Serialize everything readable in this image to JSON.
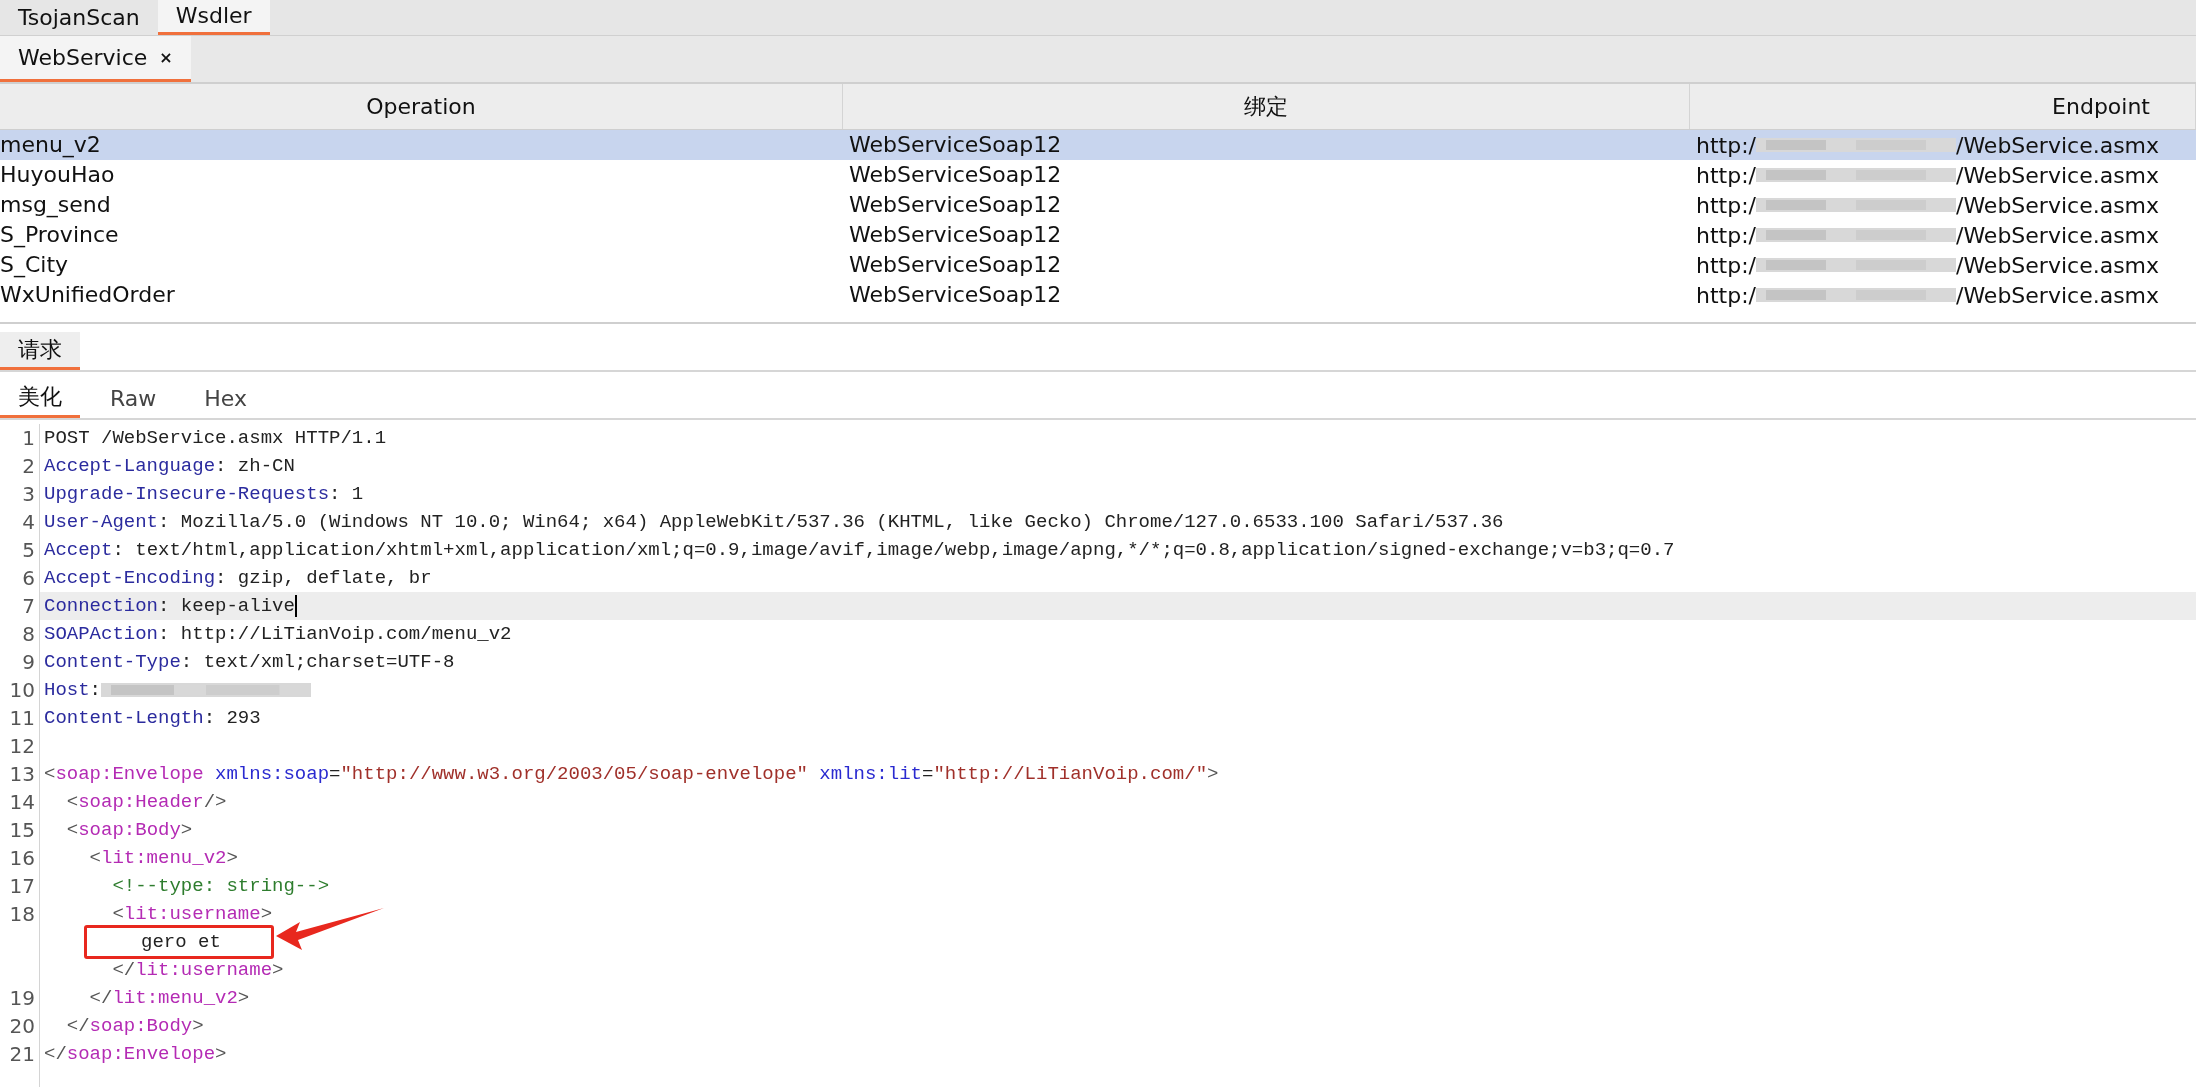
{
  "top_tabs": [
    {
      "label": "TsojanScan",
      "selected": false
    },
    {
      "label": "Wsdler",
      "selected": true
    }
  ],
  "doc_tabs": [
    {
      "label": "WebService",
      "close": "×",
      "selected": true
    }
  ],
  "table": {
    "columns": [
      "Operation",
      "绑定",
      "Endpoint"
    ],
    "rows": [
      {
        "operation": "menu_v2",
        "binding": "WebServiceSoap12",
        "endpoint_prefix": "http:/",
        "endpoint_suffix": "/WebService.asmx",
        "selected": true
      },
      {
        "operation": "HuyouHao",
        "binding": "WebServiceSoap12",
        "endpoint_prefix": "http:/",
        "endpoint_suffix": "/WebService.asmx",
        "selected": false
      },
      {
        "operation": "msg_send",
        "binding": "WebServiceSoap12",
        "endpoint_prefix": "http:/",
        "endpoint_suffix": "/WebService.asmx",
        "selected": false
      },
      {
        "operation": "S_Province",
        "binding": "WebServiceSoap12",
        "endpoint_prefix": "http:/",
        "endpoint_suffix": "/WebService.asmx",
        "selected": false
      },
      {
        "operation": "S_City",
        "binding": "WebServiceSoap12",
        "endpoint_prefix": "http:/",
        "endpoint_suffix": "/WebService.asmx",
        "selected": false
      },
      {
        "operation": "WxUnifiedOrder",
        "binding": "WebServiceSoap12",
        "endpoint_prefix": "http:/",
        "endpoint_suffix": "/WebService.asmx",
        "selected": false
      }
    ]
  },
  "panel_tabs": [
    {
      "label": "请求",
      "selected": true
    }
  ],
  "view_tabs": [
    {
      "label": "美化",
      "selected": true
    },
    {
      "label": "Raw",
      "selected": false
    },
    {
      "label": "Hex",
      "selected": false
    }
  ],
  "code": [
    {
      "number": "1",
      "current": false,
      "rows": [
        {
          "segments": [
            {
              "kind": "plain",
              "text": "POST /WebService.asmx HTTP/1.1"
            }
          ]
        }
      ]
    },
    {
      "number": "2",
      "current": false,
      "rows": [
        {
          "segments": [
            {
              "kind": "key",
              "text": "Accept-Language"
            },
            {
              "kind": "plain",
              "text": ": zh-CN"
            }
          ]
        }
      ]
    },
    {
      "number": "3",
      "current": false,
      "rows": [
        {
          "segments": [
            {
              "kind": "key",
              "text": "Upgrade-Insecure-Requests"
            },
            {
              "kind": "plain",
              "text": ": 1"
            }
          ]
        }
      ]
    },
    {
      "number": "4",
      "current": false,
      "rows": [
        {
          "segments": [
            {
              "kind": "key",
              "text": "User-Agent"
            },
            {
              "kind": "plain",
              "text": ": Mozilla/5.0 (Windows NT 10.0; Win64; x64) AppleWebKit/537.36 (KHTML, like Gecko) Chrome/127.0.6533.100 Safari/537.36"
            }
          ]
        }
      ]
    },
    {
      "number": "5",
      "current": false,
      "rows": [
        {
          "segments": [
            {
              "kind": "key",
              "text": "Accept"
            },
            {
              "kind": "plain",
              "text": ": text/html,application/xhtml+xml,application/xml;q=0.9,image/avif,image/webp,image/apng,*/*;q=0.8,application/signed-exchange;v=b3;q=0.7"
            }
          ]
        }
      ]
    },
    {
      "number": "6",
      "current": false,
      "rows": [
        {
          "segments": [
            {
              "kind": "key",
              "text": "Accept-Encoding"
            },
            {
              "kind": "plain",
              "text": ": gzip, deflate, br"
            }
          ]
        }
      ]
    },
    {
      "number": "7",
      "current": true,
      "rows": [
        {
          "segments": [
            {
              "kind": "key",
              "text": "Connection"
            },
            {
              "kind": "plain",
              "text": ": keep-alive"
            }
          ]
        }
      ]
    },
    {
      "number": "8",
      "current": false,
      "rows": [
        {
          "segments": [
            {
              "kind": "key",
              "text": "SOAPAction"
            },
            {
              "kind": "plain",
              "text": ": http://LiTianVoip.com/menu_v2"
            }
          ]
        }
      ]
    },
    {
      "number": "9",
      "current": false,
      "rows": [
        {
          "segments": [
            {
              "kind": "key",
              "text": "Content-Type"
            },
            {
              "kind": "plain",
              "text": ": text/xml;charset=UTF-8"
            }
          ]
        }
      ]
    },
    {
      "number": "10",
      "current": false,
      "rows": [
        {
          "segments": [
            {
              "kind": "key",
              "text": "Host"
            },
            {
              "kind": "plain",
              "text": ":"
            },
            {
              "kind": "redacted"
            }
          ]
        }
      ]
    },
    {
      "number": "11",
      "current": false,
      "rows": [
        {
          "segments": [
            {
              "kind": "key",
              "text": "Content-Length"
            },
            {
              "kind": "plain",
              "text": ": 293"
            }
          ]
        }
      ]
    },
    {
      "number": "12",
      "current": false,
      "rows": [
        {
          "segments": []
        }
      ]
    },
    {
      "number": "13",
      "current": false,
      "rows": [
        {
          "segments": [
            {
              "kind": "punct",
              "text": "<"
            },
            {
              "kind": "tag",
              "text": "soap:Envelope"
            },
            {
              "kind": "attr",
              "text": " xmlns:soap"
            },
            {
              "kind": "plain",
              "text": "="
            },
            {
              "kind": "value",
              "text": "\"http://www.w3.org/2003/05/soap-envelope\""
            },
            {
              "kind": "attr",
              "text": " xmlns:lit"
            },
            {
              "kind": "plain",
              "text": "="
            },
            {
              "kind": "value",
              "text": "\"http://LiTianVoip.com/\""
            },
            {
              "kind": "punct",
              "text": ">"
            }
          ]
        }
      ]
    },
    {
      "number": "14",
      "current": false,
      "rows": [
        {
          "segments": [
            {
              "kind": "punct",
              "text": "  <"
            },
            {
              "kind": "tag",
              "text": "soap:Header"
            },
            {
              "kind": "punct",
              "text": "/>"
            }
          ]
        }
      ]
    },
    {
      "number": "15",
      "current": false,
      "rows": [
        {
          "segments": [
            {
              "kind": "punct",
              "text": "  <"
            },
            {
              "kind": "tag",
              "text": "soap:Body"
            },
            {
              "kind": "punct",
              "text": ">"
            }
          ]
        }
      ]
    },
    {
      "number": "16",
      "current": false,
      "rows": [
        {
          "segments": [
            {
              "kind": "punct",
              "text": "    <"
            },
            {
              "kind": "tag",
              "text": "lit:menu_v2"
            },
            {
              "kind": "punct",
              "text": ">"
            }
          ]
        }
      ]
    },
    {
      "number": "17",
      "current": false,
      "rows": [
        {
          "segments": [
            {
              "kind": "comment",
              "text": "      <!--type: string-->"
            }
          ]
        }
      ]
    },
    {
      "number": "18",
      "current": false,
      "rows": [
        {
          "segments": [
            {
              "kind": "punct",
              "text": "      <"
            },
            {
              "kind": "tag",
              "text": "lit:username"
            },
            {
              "kind": "punct",
              "text": ">"
            }
          ]
        },
        {
          "annotated": true,
          "segments": [
            {
              "kind": "plain",
              "text": "gero et"
            }
          ]
        },
        {
          "segments": [
            {
              "kind": "punct",
              "text": "      </"
            },
            {
              "kind": "tag",
              "text": "lit:username"
            },
            {
              "kind": "punct",
              "text": ">"
            }
          ]
        }
      ]
    },
    {
      "number": "19",
      "current": false,
      "rows": [
        {
          "segments": [
            {
              "kind": "punct",
              "text": "    </"
            },
            {
              "kind": "tag",
              "text": "lit:menu_v2"
            },
            {
              "kind": "punct",
              "text": ">"
            }
          ]
        }
      ]
    },
    {
      "number": "20",
      "current": false,
      "rows": [
        {
          "segments": [
            {
              "kind": "punct",
              "text": "  </"
            },
            {
              "kind": "tag",
              "text": "soap:Body"
            },
            {
              "kind": "punct",
              "text": ">"
            }
          ]
        }
      ]
    },
    {
      "number": "21",
      "current": false,
      "rows": [
        {
          "segments": [
            {
              "kind": "punct",
              "text": "</"
            },
            {
              "kind": "tag",
              "text": "soap:Envelope"
            },
            {
              "kind": "punct",
              "text": ">"
            }
          ]
        }
      ]
    }
  ]
}
